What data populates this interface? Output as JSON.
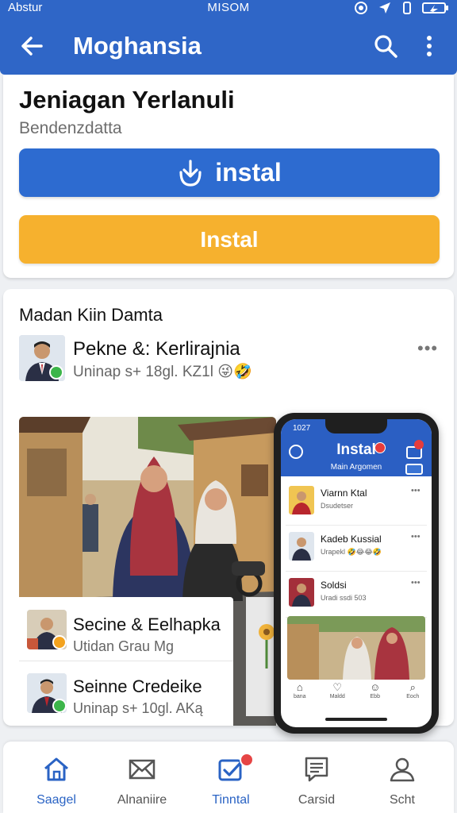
{
  "status_bar": {
    "left": "Abstur",
    "center": "MISOM"
  },
  "app_bar": {
    "title": "Moghansia",
    "back_icon": "arrow-left-icon",
    "search_icon": "search-icon",
    "more_icon": "more-vertical-icon"
  },
  "app_info": {
    "name": "Jeniagan Yerlanuli",
    "developer": "Bendenzdatta",
    "install_primary_label": "instal",
    "install_primary_icon": "download-icon",
    "install_secondary_label": "Instal"
  },
  "feed": {
    "section_title": "Madan Kiin Damta",
    "post": {
      "name": "Pekne &: Kerlirajnia",
      "meta": "Uninap s+ 18gl. KZ1l 😜🤣",
      "more": "•••"
    },
    "overlay_items": [
      {
        "name": "Secine & Eelhapka",
        "meta": "Utidan Grau Mg"
      },
      {
        "name": "Seinne Credeike",
        "meta": "Uninap s+ 10gl. AKą"
      }
    ]
  },
  "phone": {
    "time": "1027",
    "title": "Instal",
    "subtitle": "Main Argomen",
    "items": [
      {
        "name": "Viarnn Ktal",
        "meta": "Dsudetser",
        "more": "•••"
      },
      {
        "name": "Kadeb Kussial",
        "meta": "Urapekl 🤣😂😂🤣",
        "more": "•••"
      },
      {
        "name": "Soldsi",
        "meta": "Uradi ssdi 503",
        "more": "•••"
      }
    ],
    "nav": [
      {
        "icon": "⌂",
        "label": "bana"
      },
      {
        "icon": "♡",
        "label": "Maldd"
      },
      {
        "icon": "☺",
        "label": "Ebb"
      },
      {
        "icon": "⌕",
        "label": "Eoch"
      }
    ]
  },
  "bottom_nav": [
    {
      "label": "Saagel",
      "icon": "home-icon",
      "active": true
    },
    {
      "label": "Alnaniire",
      "icon": "mail-icon",
      "active": false
    },
    {
      "label": "Tinntal",
      "icon": "install-badge-icon",
      "active": true
    },
    {
      "label": "Carsid",
      "icon": "document-icon",
      "active": false
    },
    {
      "label": "Scht",
      "icon": "profile-icon",
      "active": false
    }
  ],
  "colors": {
    "primary": "#2f66c7",
    "install_blue": "#2d6bd0",
    "install_yellow": "#f6b12e",
    "verified_green": "#3cb54a"
  }
}
